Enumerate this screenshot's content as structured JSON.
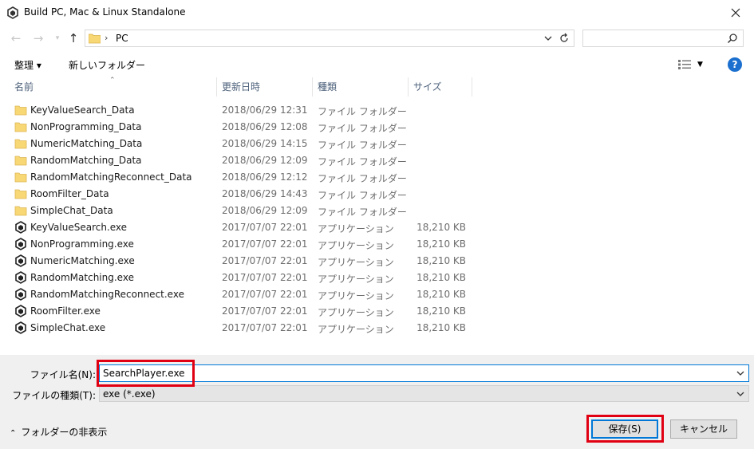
{
  "window": {
    "title": "Build PC, Mac & Linux Standalone"
  },
  "address": {
    "crumbs": [
      "PC"
    ]
  },
  "search": {
    "placeholder": ""
  },
  "toolbar": {
    "organize_label": "整理 ▾",
    "new_folder_label": "新しいフォルダー"
  },
  "columns": {
    "name": "名前",
    "date": "更新日時",
    "type": "種類",
    "size": "サイズ"
  },
  "files": [
    {
      "name": "KeyValueSearch_Data",
      "date": "2018/06/29 12:31",
      "type": "ファイル フォルダー",
      "size": "",
      "icon": "folder-icon"
    },
    {
      "name": "NonProgramming_Data",
      "date": "2018/06/29 12:08",
      "type": "ファイル フォルダー",
      "size": "",
      "icon": "folder-icon"
    },
    {
      "name": "NumericMatching_Data",
      "date": "2018/06/29 14:15",
      "type": "ファイル フォルダー",
      "size": "",
      "icon": "folder-icon"
    },
    {
      "name": "RandomMatching_Data",
      "date": "2018/06/29 12:09",
      "type": "ファイル フォルダー",
      "size": "",
      "icon": "folder-icon"
    },
    {
      "name": "RandomMatchingReconnect_Data",
      "date": "2018/06/29 12:12",
      "type": "ファイル フォルダー",
      "size": "",
      "icon": "folder-icon"
    },
    {
      "name": "RoomFilter_Data",
      "date": "2018/06/29 14:43",
      "type": "ファイル フォルダー",
      "size": "",
      "icon": "folder-icon"
    },
    {
      "name": "SimpleChat_Data",
      "date": "2018/06/29 12:09",
      "type": "ファイル フォルダー",
      "size": "",
      "icon": "folder-icon"
    },
    {
      "name": "KeyValueSearch.exe",
      "date": "2017/07/07 22:01",
      "type": "アプリケーション",
      "size": "18,210 KB",
      "icon": "unity-icon"
    },
    {
      "name": "NonProgramming.exe",
      "date": "2017/07/07 22:01",
      "type": "アプリケーション",
      "size": "18,210 KB",
      "icon": "unity-icon"
    },
    {
      "name": "NumericMatching.exe",
      "date": "2017/07/07 22:01",
      "type": "アプリケーション",
      "size": "18,210 KB",
      "icon": "unity-icon"
    },
    {
      "name": "RandomMatching.exe",
      "date": "2017/07/07 22:01",
      "type": "アプリケーション",
      "size": "18,210 KB",
      "icon": "unity-icon"
    },
    {
      "name": "RandomMatchingReconnect.exe",
      "date": "2017/07/07 22:01",
      "type": "アプリケーション",
      "size": "18,210 KB",
      "icon": "unity-icon"
    },
    {
      "name": "RoomFilter.exe",
      "date": "2017/07/07 22:01",
      "type": "アプリケーション",
      "size": "18,210 KB",
      "icon": "unity-icon"
    },
    {
      "name": "SimpleChat.exe",
      "date": "2017/07/07 22:01",
      "type": "アプリケーション",
      "size": "18,210 KB",
      "icon": "unity-icon"
    }
  ],
  "form": {
    "filename_label": "ファイル名(N):",
    "filename_value": "SearchPlayer.exe",
    "filetype_label": "ファイルの種類(T):",
    "filetype_value": "exe (*.exe)"
  },
  "footer": {
    "hide_folders_label": "フォルダーの非表示",
    "save_label": "保存(S)",
    "cancel_label": "キャンセル"
  },
  "colors": {
    "accent": "#0078d7",
    "highlight": "#e00012",
    "folder": "#f8d775",
    "help": "#1a6fcf"
  }
}
